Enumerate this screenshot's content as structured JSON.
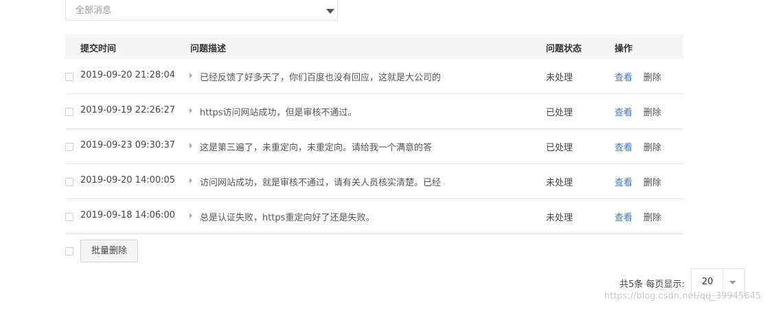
{
  "filter": {
    "value": "全部消息",
    "icon": "caret-down-icon"
  },
  "table": {
    "headers": {
      "time": "提交时间",
      "desc": "问题描述",
      "status": "问题状态",
      "ops": "操作"
    },
    "rows": [
      {
        "time": "2019-09-20 21:28:04",
        "desc": "已经反馈了好多天了，你们百度也没有回应，这就是大公司的",
        "status": "未处理",
        "view": "查看",
        "del": "删除"
      },
      {
        "time": "2019-09-19 22:26:27",
        "desc": "https访问网站成功，但是审核不通过。",
        "status": "已处理",
        "view": "查看",
        "del": "删除"
      },
      {
        "time": "2019-09-23 09:30:37",
        "desc": "这是第三遍了，未重定向，未重定向。请给我一个满意的答",
        "status": "已处理",
        "view": "查看",
        "del": "删除"
      },
      {
        "time": "2019-09-20 14:00:05",
        "desc": "访问网站成功，就是审核不通过，请有关人员核实清楚。已经",
        "status": "未处理",
        "view": "查看",
        "del": "删除"
      },
      {
        "time": "2019-09-18 14:06:00",
        "desc": "总是认证失败，https重定向好了还是失败。",
        "status": "未处理",
        "view": "查看",
        "del": "删除"
      }
    ]
  },
  "batch": {
    "delete_label": "批量删除"
  },
  "pager": {
    "total": "共5条 每页显示:",
    "page_size": "20"
  },
  "watermark": "https://blog.csdn.net/qq_39945645",
  "colors": {
    "link": "#3a7cc8",
    "header_bg": "#f5f5f5"
  }
}
